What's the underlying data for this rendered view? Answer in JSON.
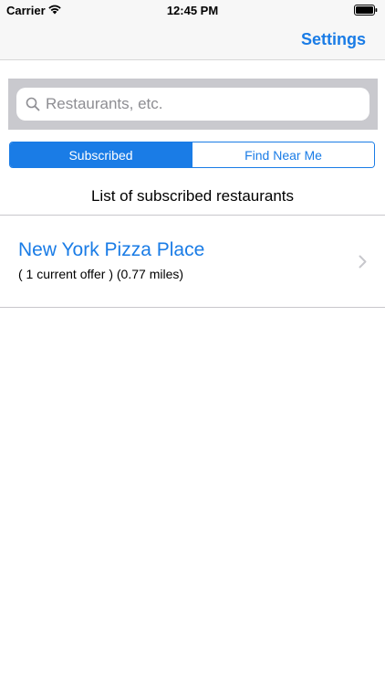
{
  "status_bar": {
    "carrier": "Carrier",
    "time": "12:45 PM",
    "icons": [
      "wifi-icon",
      "battery-icon"
    ]
  },
  "nav_bar": {
    "settings_label": "Settings"
  },
  "search": {
    "placeholder": "Restaurants, etc.",
    "value": "",
    "icon": "search-icon"
  },
  "segments": {
    "items": [
      {
        "label": "Subscribed",
        "selected": true
      },
      {
        "label": "Find Near Me",
        "selected": false
      }
    ]
  },
  "list": {
    "heading": "List of subscribed restaurants",
    "restaurants": [
      {
        "name": "New York Pizza Place",
        "detail": "( 1 current offer ) (0.77 miles)"
      }
    ]
  },
  "colors": {
    "accent": "#1a7ce6",
    "bar_background": "#f7f7f7",
    "search_background": "#c9c9ce",
    "placeholder": "#8e8e93"
  }
}
